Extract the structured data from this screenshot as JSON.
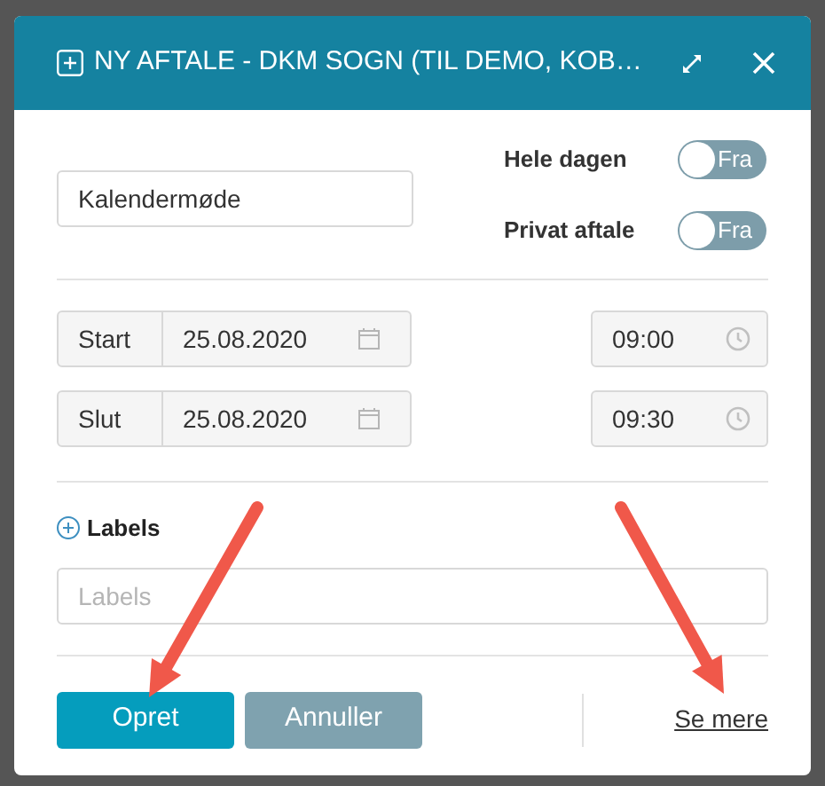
{
  "dialog": {
    "title": "NY AFTALE - DKM SOGN (TIL DEMO, KOB…"
  },
  "subject": {
    "value": "Kalendermøde"
  },
  "toggles": [
    {
      "label": "Hele dagen",
      "on": false,
      "state_text": "Fra"
    },
    {
      "label": "Privat aftale",
      "on": false,
      "state_text": "Fra"
    }
  ],
  "times": [
    {
      "label": "Start",
      "date": "25.08.2020",
      "time": "09:00"
    },
    {
      "label": "Slut",
      "date": "25.08.2020",
      "time": "09:30"
    }
  ],
  "labels": {
    "heading": "Labels",
    "placeholder": "Labels"
  },
  "buttons": [
    {
      "label": "Opret",
      "kind": "primary"
    },
    {
      "label": "Annuller",
      "kind": "secondary"
    }
  ],
  "link": "Se mere"
}
